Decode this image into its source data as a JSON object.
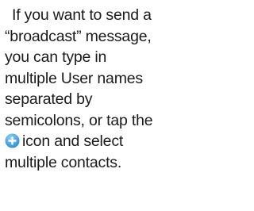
{
  "help": {
    "line1": "If you want to send a",
    "line2": "“broadcast” message,",
    "line3": "you can type in",
    "line4": "multiple User names",
    "line5": "separated by",
    "line6": "semicolons, or tap the",
    "line7_after_icon": "icon and select",
    "line8": "multiple contacts."
  },
  "icon": {
    "name": "add-contact-icon",
    "color": "#4aa3df",
    "highlight": "#7cc4f0"
  }
}
